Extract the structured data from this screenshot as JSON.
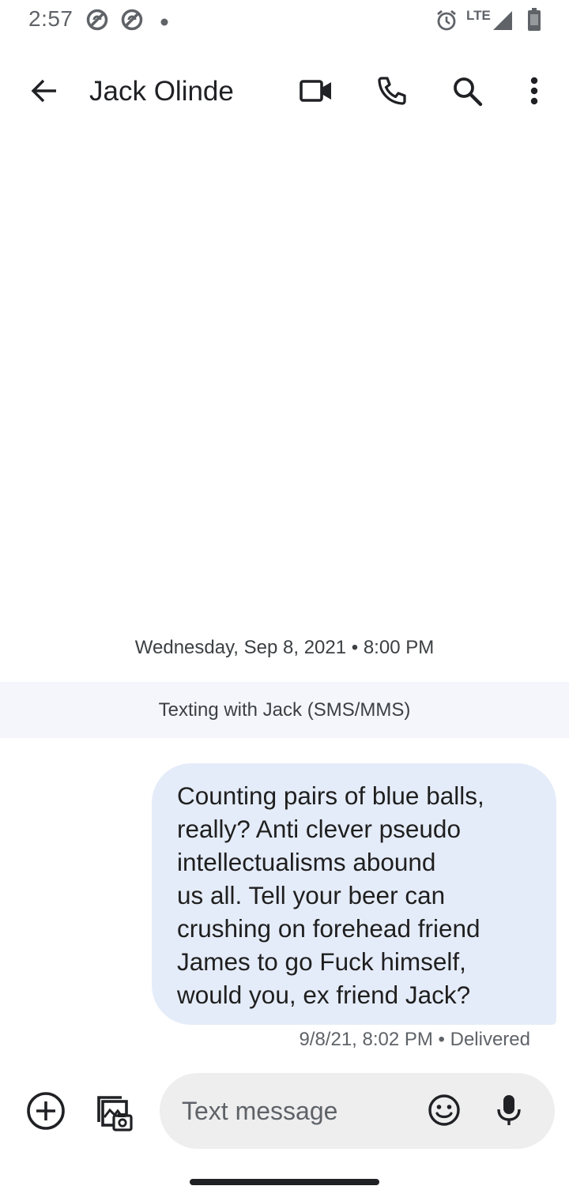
{
  "status_bar": {
    "time": "2:57",
    "network": "LTE",
    "icons": [
      "do-not-disturb-icon",
      "do-not-disturb-icon",
      "notification-dot-icon",
      "alarm-icon",
      "cell-signal-icon",
      "battery-icon"
    ]
  },
  "header": {
    "contact_name": "Jack Olinde",
    "actions": [
      "back-arrow-icon",
      "video-call-icon",
      "phone-icon",
      "search-icon",
      "more-vert-icon"
    ]
  },
  "conversation": {
    "date_header": "Wednesday, Sep 8, 2021 • 8:00 PM",
    "texting_banner": "Texting with Jack (SMS/MMS)",
    "messages": [
      {
        "direction": "outgoing",
        "lines": [
          "Counting pairs of blue balls,",
          "really? Anti clever pseudo",
          "intellectualisms abound",
          "us all. Tell your beer can",
          "crushing on forehead friend",
          "James to go Fuck himself,",
          "would you, ex friend Jack?"
        ],
        "meta": "9/8/21, 8:02 PM • Delivered"
      }
    ]
  },
  "compose": {
    "placeholder": "Text message",
    "value": "",
    "icons": [
      "add-circle-icon",
      "gallery-camera-icon",
      "emoji-icon",
      "microphone-icon"
    ]
  },
  "colors": {
    "bubble": "#e5ecf9",
    "banner": "#f4f6fb",
    "compose_field": "#eeeeef",
    "icon": "#202124",
    "status_icon": "#5f6368"
  }
}
